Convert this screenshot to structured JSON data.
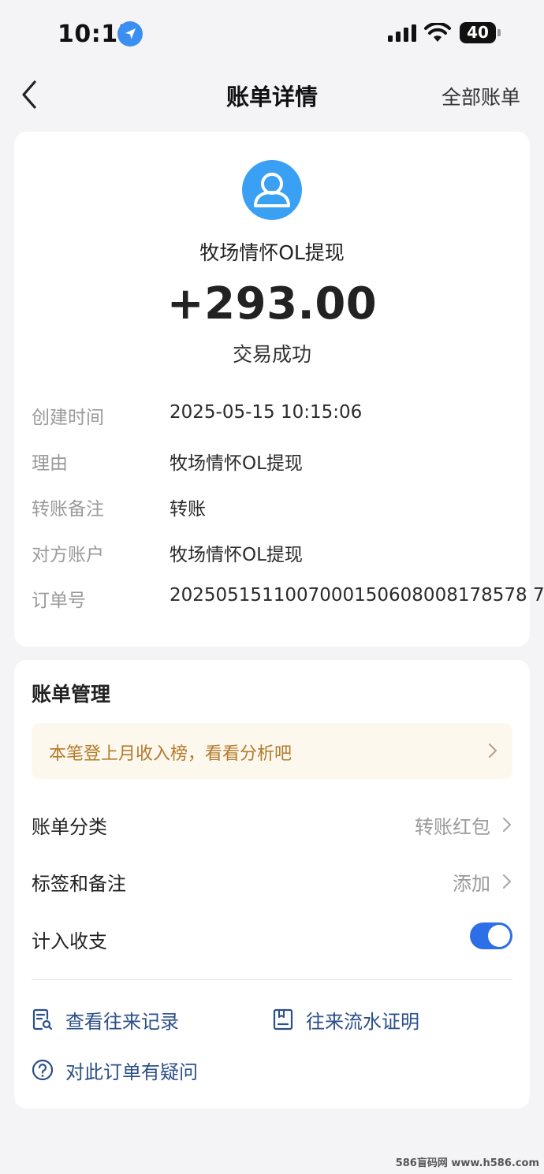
{
  "status_bar": {
    "time": "10:15",
    "battery": "40"
  },
  "nav": {
    "title": "账单详情",
    "right_link": "全部账单"
  },
  "transaction": {
    "merchant": "牧场情怀OL提现",
    "amount": "+293.00",
    "status": "交易成功",
    "details": [
      {
        "label": "创建时间",
        "value": "2025-05-15 10:15:06"
      },
      {
        "label": "理由",
        "value": "牧场情怀OL提现"
      },
      {
        "label": "转账备注",
        "value": "转账"
      },
      {
        "label": "对方账户",
        "value": "牧场情怀OL提现"
      },
      {
        "label": "订单号",
        "value": "2025051511007000150608008178578 7"
      }
    ]
  },
  "management": {
    "title": "账单管理",
    "banner": "本笔登上月收入榜，看看分析吧",
    "category_label": "账单分类",
    "category_value": "转账红包",
    "tags_label": "标签和备注",
    "tags_value": "添加",
    "count_label": "计入收支",
    "count_enabled": true,
    "links": {
      "history": "查看往来记录",
      "proof": "往来流水证明",
      "question": "对此订单有疑问"
    }
  },
  "watermark": "586盲码网 www.h586.com",
  "colors": {
    "accent": "#2c6fe6",
    "link": "#2b4f8a",
    "banner_text": "#b37a2a",
    "avatar": "#3aa0f3"
  }
}
